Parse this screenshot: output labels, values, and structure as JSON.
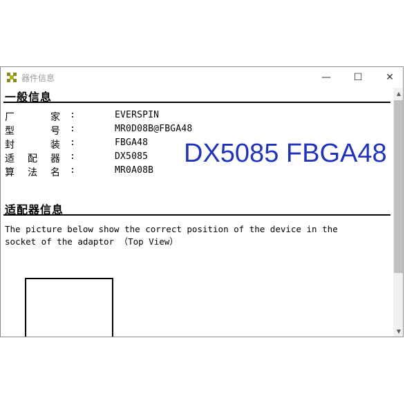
{
  "window": {
    "title": "器件信息",
    "minimize_glyph": "—",
    "maximize_glyph": "☐",
    "close_glyph": "✕"
  },
  "general_info": {
    "heading": "一般信息",
    "rows": [
      {
        "label": [
          "厂",
          "家"
        ],
        "colon": ":",
        "value": "EVERSPIN"
      },
      {
        "label": [
          "型",
          "号"
        ],
        "colon": ":",
        "value": "MR0D08B@FBGA48"
      },
      {
        "label": [
          "封",
          "装"
        ],
        "colon": ":",
        "value": "FBGA48"
      },
      {
        "label": [
          "适",
          "配",
          "器"
        ],
        "colon": ":",
        "value": "DX5085"
      },
      {
        "label": [
          "算",
          "法",
          "名"
        ],
        "colon": ":",
        "value": "MR0A08B"
      }
    ]
  },
  "overlay_text": "DX5085 FBGA48",
  "adaptor_info": {
    "heading": "适配器信息",
    "description_line1": "The picture below show the correct position of the device in the",
    "description_line2": "socket of the adaptor （Top View）"
  },
  "scrollbar": {
    "up_glyph": "▲",
    "down_glyph": "▼"
  },
  "colors": {
    "overlay_text": "#2233bb",
    "icon": "#8a8a1a",
    "title_text": "#9a9a9a"
  },
  "icons": {
    "app": "adaptor-cross-icon",
    "minimize": "minimize-icon",
    "maximize": "maximize-icon",
    "close": "close-icon"
  }
}
